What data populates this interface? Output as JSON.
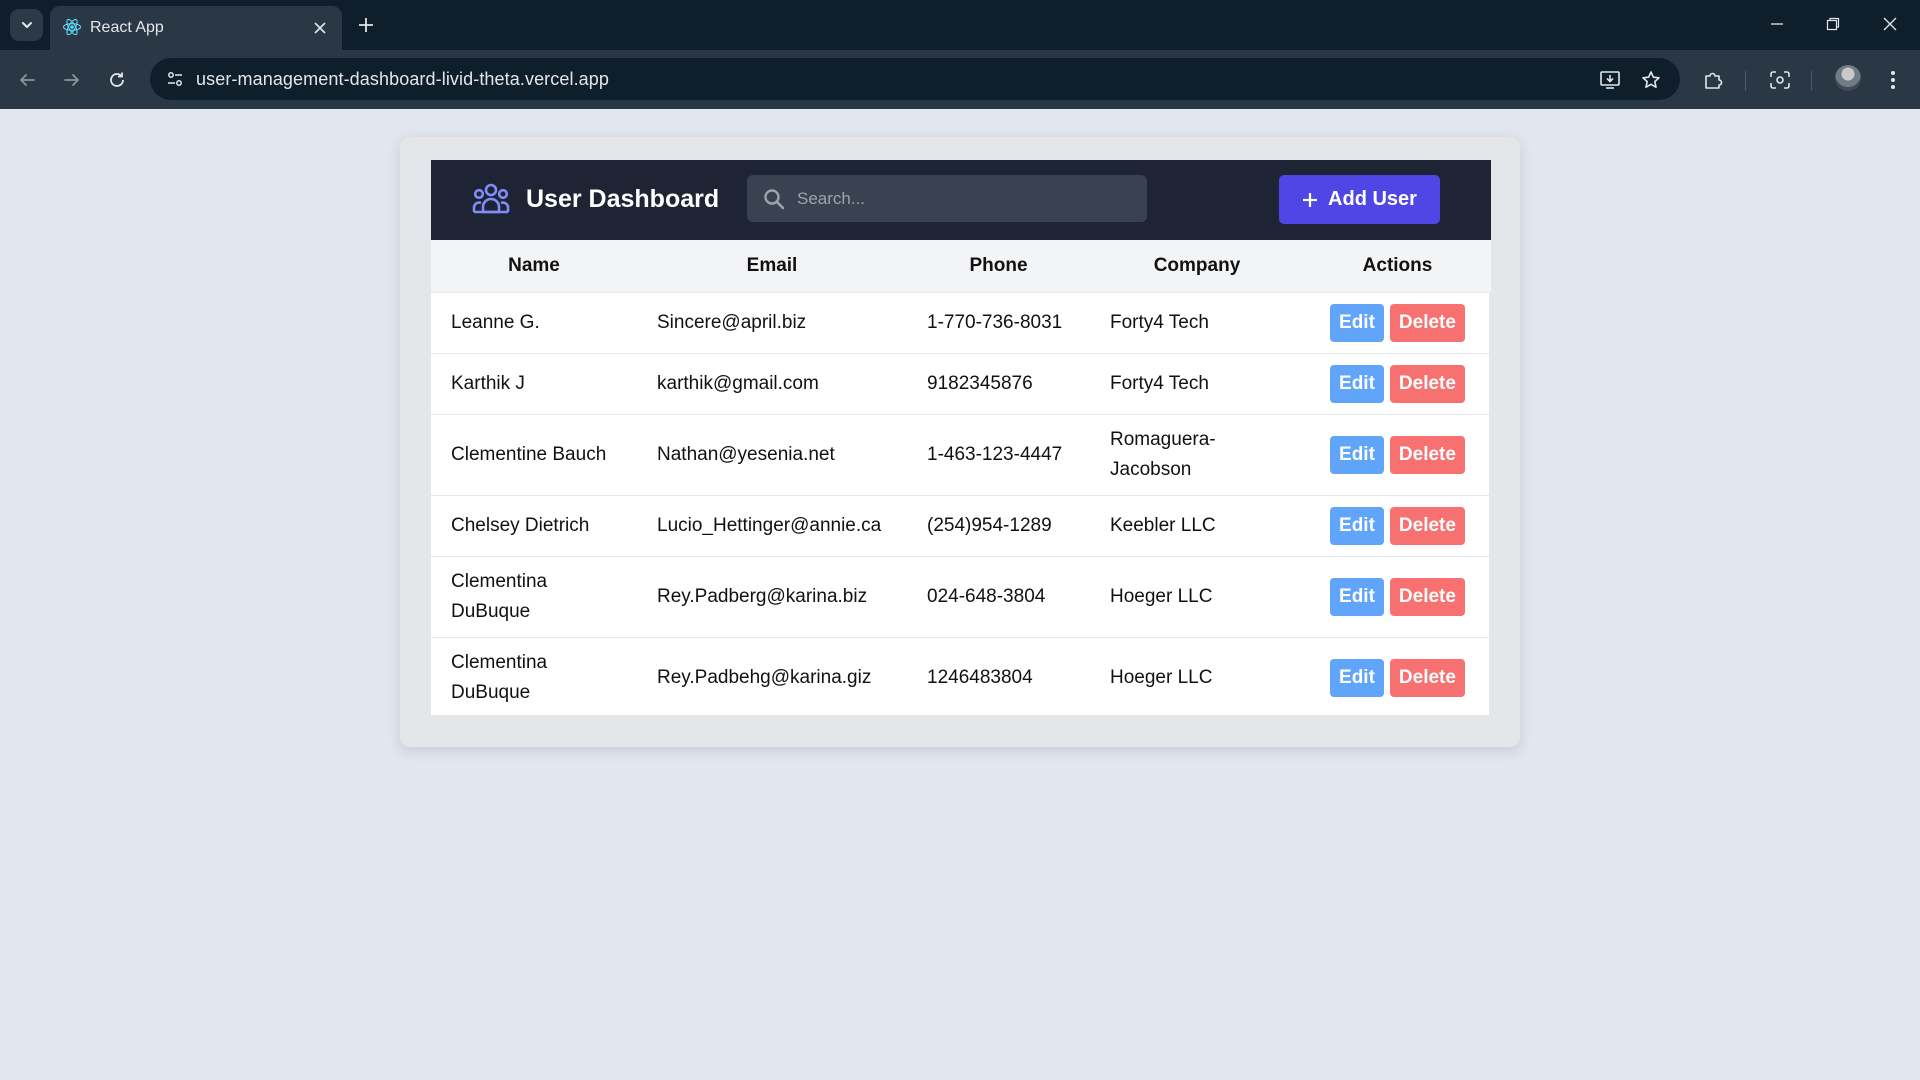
{
  "browser": {
    "tab_title": "React App",
    "url": "user-management-dashboard-livid-theta.vercel.app"
  },
  "dashboard": {
    "title": "User Dashboard",
    "search_placeholder": "Search...",
    "add_user_label": "Add User"
  },
  "table": {
    "columns": [
      "Name",
      "Email",
      "Phone",
      "Company",
      "Actions"
    ],
    "edit_label": "Edit",
    "delete_label": "Delete",
    "rows": [
      {
        "name": "Leanne G.",
        "email": "Sincere@april.biz",
        "phone": "1-770-736-8031",
        "company": "Forty4 Tech"
      },
      {
        "name": "Karthik J",
        "email": "karthik@gmail.com",
        "phone": "9182345876",
        "company": "Forty4 Tech"
      },
      {
        "name": "Clementine Bauch",
        "email": "Nathan@yesenia.net",
        "phone": "1-463-123-4447",
        "company": "Romaguera-Jacobson"
      },
      {
        "name": "Chelsey Dietrich",
        "email": "Lucio_Hettinger@annie.ca",
        "phone": "(254)954-1289",
        "company": "Keebler LLC"
      },
      {
        "name": "Clementina DuBuque",
        "email": "Rey.Padberg@karina.biz",
        "phone": "024-648-3804",
        "company": "Hoeger LLC"
      },
      {
        "name": "Clementina DuBuque",
        "email": "Rey.Padbehg@karina.giz",
        "phone": "1246483804",
        "company": "Hoeger LLC"
      }
    ]
  },
  "colors": {
    "header_bg": "#1e2433",
    "accent": "#4f46e5",
    "edit": "#60a5fa",
    "delete": "#f87171"
  }
}
